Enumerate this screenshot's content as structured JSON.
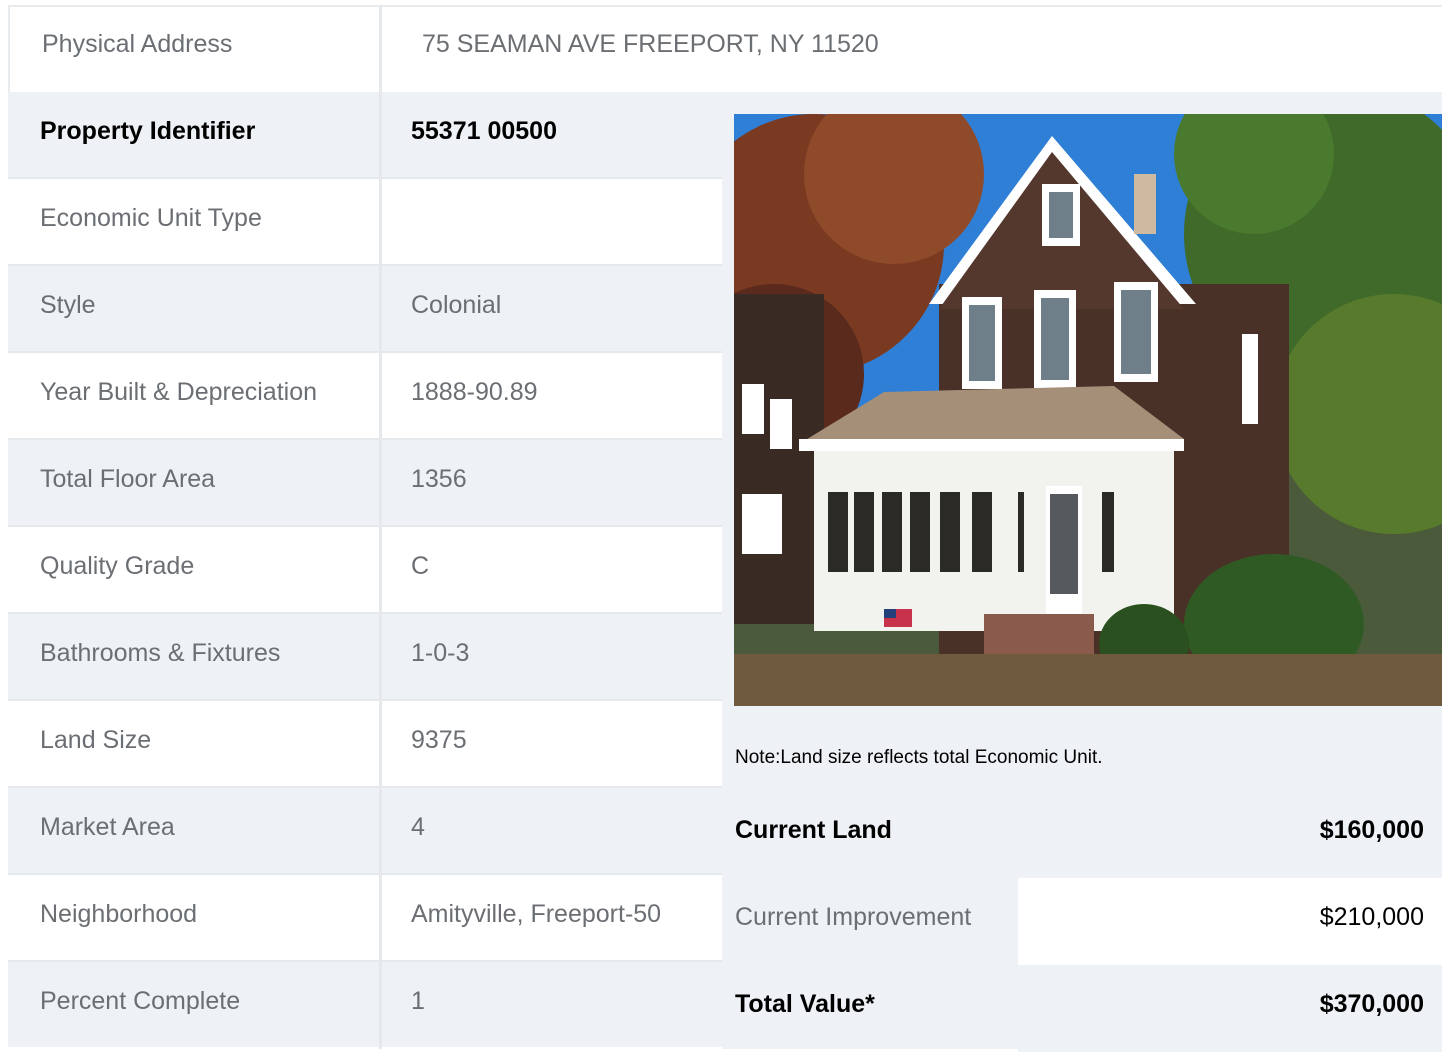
{
  "address": {
    "label": "Physical Address",
    "value": "75  SEAMAN AVE  FREEPORT, NY  11520"
  },
  "details": [
    {
      "label": "Property Identifier",
      "value": "55371  00500"
    },
    {
      "label": "Economic Unit Type",
      "value": ""
    },
    {
      "label": "Style",
      "value": "Colonial"
    },
    {
      "label": "Year Built & Depreciation",
      "value": "1888-90.89"
    },
    {
      "label": "Total Floor Area",
      "value": "1356"
    },
    {
      "label": "Quality Grade",
      "value": "C"
    },
    {
      "label": "Bathrooms & Fixtures",
      "value": "1-0-3"
    },
    {
      "label": "Land Size",
      "value": "9375"
    },
    {
      "label": "Market Area",
      "value": "4"
    },
    {
      "label": "Neighborhood",
      "value": "Amityville, Freeport-50"
    },
    {
      "label": "Percent Complete",
      "value": "1"
    }
  ],
  "note": "Note:Land size reflects total Economic Unit.",
  "valuation": {
    "land": {
      "label": "Current Land",
      "value": "$160,000"
    },
    "improvement": {
      "label": "Current Improvement",
      "value": "$210,000"
    },
    "total": {
      "label": "Total Value*",
      "value": "$370,000"
    }
  },
  "colors": {
    "alt_row": "#eef1f5",
    "border": "#e6e9ec",
    "text_muted": "#6b6f73",
    "text_strong": "#000000"
  }
}
